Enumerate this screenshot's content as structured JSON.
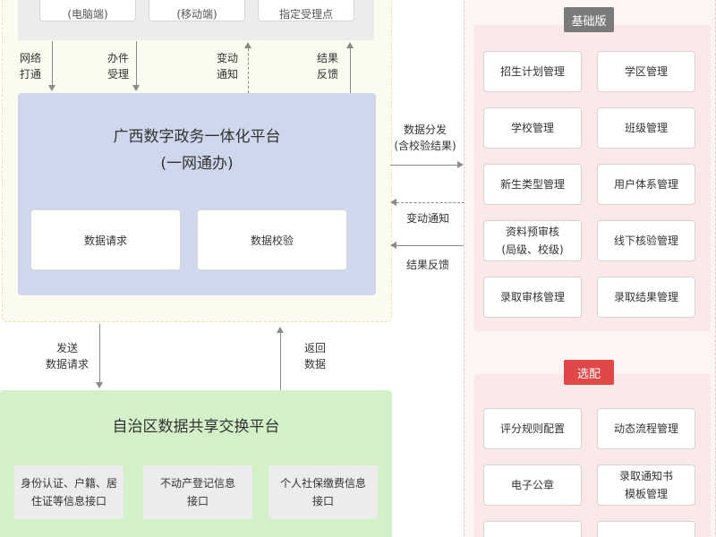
{
  "channels": [
    {
      "label": "(电脑端)"
    },
    {
      "label": "(移动端)"
    },
    {
      "label": "指定受理点"
    }
  ],
  "top_arrows": [
    {
      "label": "网络\n打通"
    },
    {
      "label": "办件\n受理"
    },
    {
      "label": "变动\n通知"
    },
    {
      "label": "结果\n反馈"
    }
  ],
  "platform": {
    "title": "广西数字政务一体化平台\n(一网通办)",
    "boxes": [
      {
        "label": "数据请求"
      },
      {
        "label": "数据校验"
      }
    ]
  },
  "side_arrows": [
    {
      "label": "数据分发\n(含校验结果)"
    },
    {
      "label": "变动通知"
    },
    {
      "label": "结果反馈"
    }
  ],
  "bottom_arrows": [
    {
      "label": "发送\n数据请求"
    },
    {
      "label": "返回\n数据"
    }
  ],
  "exchange": {
    "title": "自治区数据共享交换平台",
    "apis": [
      {
        "label": "身份认证、户籍、居\n住证等信息接口"
      },
      {
        "label": "不动产登记信息\n接口"
      },
      {
        "label": "个人社保缴费信息\n接口"
      }
    ]
  },
  "basic": {
    "badge": "基础版",
    "badge_color": "#7a7a7a",
    "modules": [
      {
        "label": "招生计划管理"
      },
      {
        "label": "学区管理"
      },
      {
        "label": "学校管理"
      },
      {
        "label": "班级管理"
      },
      {
        "label": "新生类型管理"
      },
      {
        "label": "用户体系管理"
      },
      {
        "label": "资料预审核\n(局级、校级)"
      },
      {
        "label": "线下核验管理"
      },
      {
        "label": "录取审核管理"
      },
      {
        "label": "录取结果管理"
      }
    ]
  },
  "optional": {
    "badge": "选配",
    "badge_color": "#e04848",
    "modules": [
      {
        "label": "评分规则配置"
      },
      {
        "label": "动态流程管理"
      },
      {
        "label": "电子公章"
      },
      {
        "label": "录取通知书\n模板管理"
      },
      {
        "label": ""
      },
      {
        "label": ""
      }
    ]
  }
}
